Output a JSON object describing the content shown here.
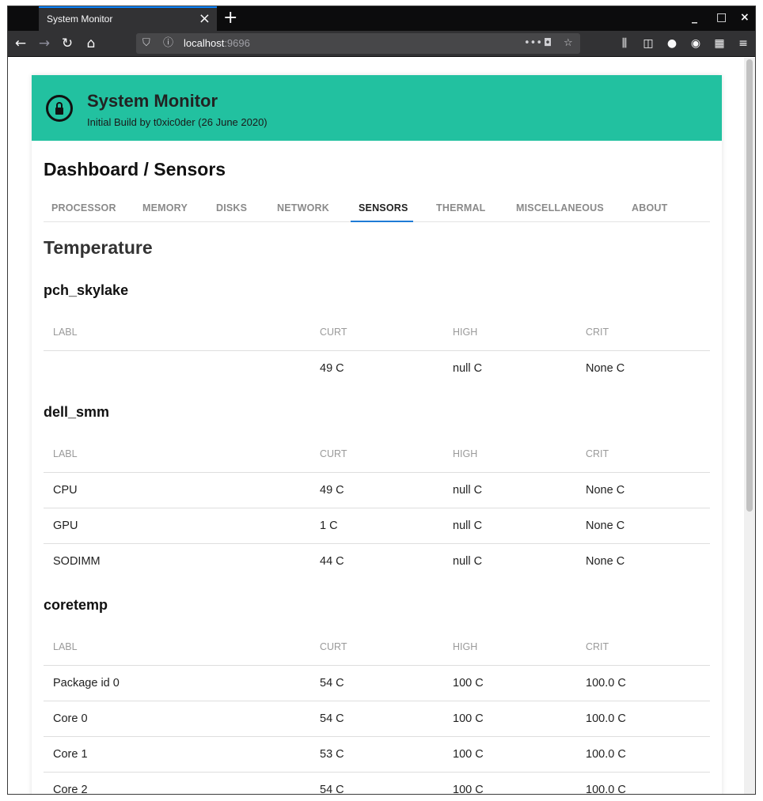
{
  "browser": {
    "tab_title": "System Monitor",
    "url_host": "localhost",
    "url_port": ":9696"
  },
  "header": {
    "title": "System Monitor",
    "subtitle": "Initial Build by t0xic0der (26 June 2020)"
  },
  "page_title": "Dashboard / Sensors",
  "tabs": [
    {
      "label": "PROCESSOR"
    },
    {
      "label": "MEMORY"
    },
    {
      "label": "DISKS"
    },
    {
      "label": "NETWORK"
    },
    {
      "label": "SENSORS"
    },
    {
      "label": "THERMAL"
    },
    {
      "label": "MISCELLANEOUS"
    },
    {
      "label": "ABOUT"
    }
  ],
  "active_tab": "SENSORS",
  "section_title": "Temperature",
  "columns": [
    "LABL",
    "CURT",
    "HIGH",
    "CRIT"
  ],
  "groups": [
    {
      "name": "pch_skylake",
      "rows": [
        [
          "",
          "49 C",
          "null C",
          "None C"
        ]
      ]
    },
    {
      "name": "dell_smm",
      "rows": [
        [
          "CPU",
          "49 C",
          "null C",
          "None C"
        ],
        [
          "GPU",
          "1 C",
          "null C",
          "None C"
        ],
        [
          "SODIMM",
          "44 C",
          "null C",
          "None C"
        ]
      ]
    },
    {
      "name": "coretemp",
      "rows": [
        [
          "Package id 0",
          "54 C",
          "100 C",
          "100.0 C"
        ],
        [
          "Core 0",
          "54 C",
          "100 C",
          "100.0 C"
        ],
        [
          "Core 1",
          "53 C",
          "100 C",
          "100.0 C"
        ],
        [
          "Core 2",
          "54 C",
          "100 C",
          "100.0 C"
        ]
      ]
    }
  ],
  "colors": {
    "header_bg": "#22c1a0",
    "tab_active_underline": "#1e7bd6"
  }
}
